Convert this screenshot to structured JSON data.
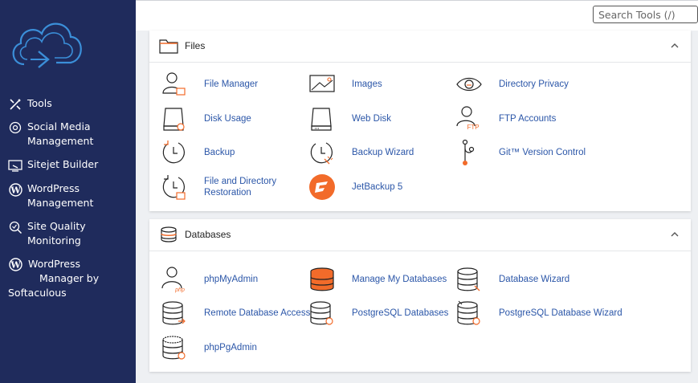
{
  "search": {
    "placeholder": "Search Tools (/)"
  },
  "sidebar": {
    "items": [
      {
        "label": "Tools",
        "icon": "tools-icon"
      },
      {
        "label": "Social Media Management",
        "icon": "social-media-icon"
      },
      {
        "label": "Sitejet Builder",
        "icon": "sitejet-icon"
      },
      {
        "label": "WordPress Management",
        "icon": "wordpress-icon"
      },
      {
        "label": "Site Quality Monitoring",
        "icon": "site-quality-icon"
      }
    ],
    "softaculous": {
      "line1": "WordPress",
      "line2": "Manager by",
      "line3": "Softaculous",
      "icon": "wordpress-icon"
    }
  },
  "files": {
    "title": "Files",
    "items": [
      {
        "label": "File Manager",
        "icon": "file-manager-icon"
      },
      {
        "label": "Images",
        "icon": "images-icon"
      },
      {
        "label": "Directory Privacy",
        "icon": "directory-privacy-icon"
      },
      {
        "label": "Disk Usage",
        "icon": "disk-usage-icon"
      },
      {
        "label": "Web Disk",
        "icon": "web-disk-icon"
      },
      {
        "label": "FTP Accounts",
        "icon": "ftp-accounts-icon"
      },
      {
        "label": "Backup",
        "icon": "backup-icon"
      },
      {
        "label": "Backup Wizard",
        "icon": "backup-wizard-icon"
      },
      {
        "label": "Git™ Version Control",
        "icon": "git-icon"
      },
      {
        "label": "File and Directory Restoration",
        "icon": "restoration-icon"
      },
      {
        "label": "JetBackup 5",
        "icon": "jetbackup-icon"
      }
    ]
  },
  "databases": {
    "title": "Databases",
    "items": [
      {
        "label": "phpMyAdmin",
        "icon": "phpmyadmin-icon"
      },
      {
        "label": "Manage My Databases",
        "icon": "manage-databases-icon"
      },
      {
        "label": "Database Wizard",
        "icon": "database-wizard-icon"
      },
      {
        "label": "Remote Database Access",
        "icon": "remote-database-icon"
      },
      {
        "label": "PostgreSQL Databases",
        "icon": "postgresql-databases-icon"
      },
      {
        "label": "PostgreSQL Database Wizard",
        "icon": "postgresql-wizard-icon"
      },
      {
        "label": "phpPgAdmin",
        "icon": "phppgadmin-icon"
      }
    ]
  },
  "colors": {
    "sidebar": "#1f2b5c",
    "link": "#2b56a8",
    "accent": "#f26b2a"
  }
}
